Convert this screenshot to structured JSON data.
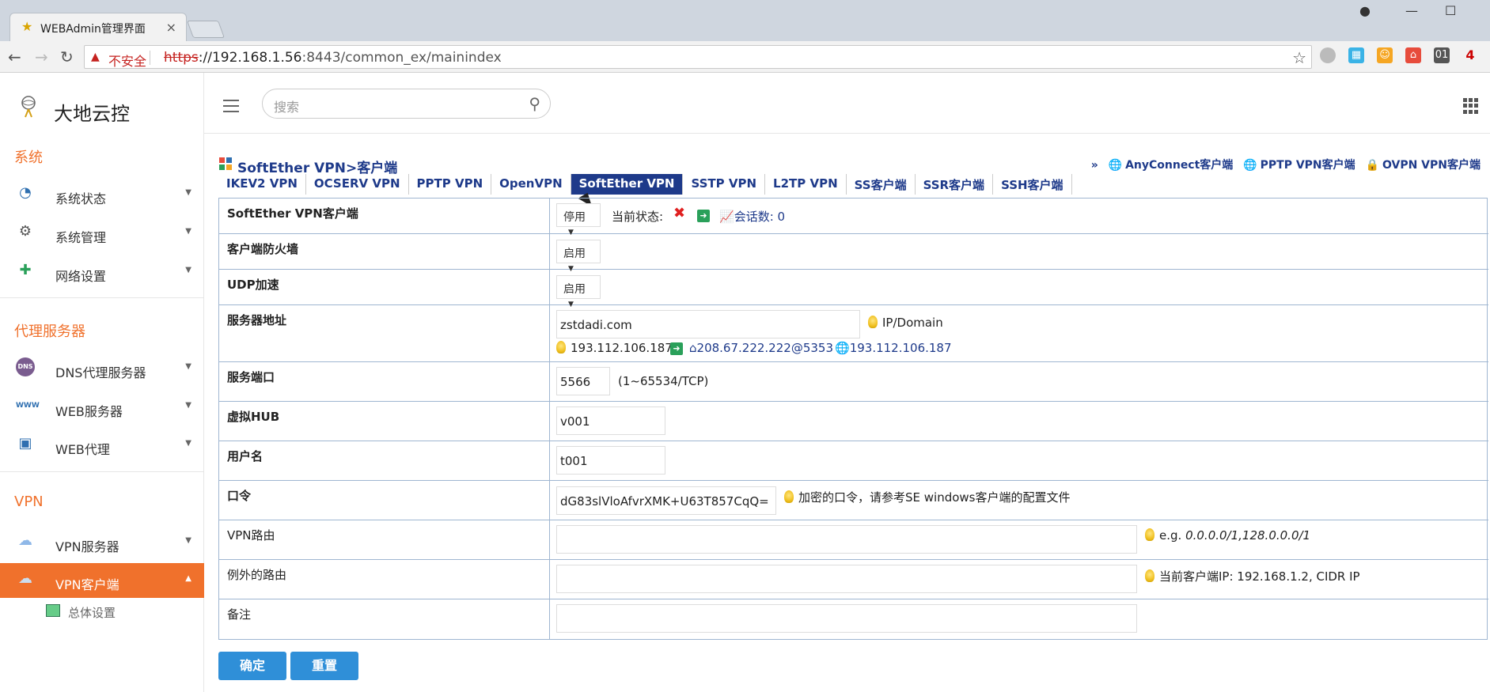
{
  "browser": {
    "tab_title": "WEBAdmin管理界面",
    "tab_close": "×",
    "insecure_label": "不安全",
    "url_proto": "https",
    "url_host": "://192.168.1.56",
    "url_rest": ":8443/common_ex/mainindex"
  },
  "app": {
    "logo_text": "大地云控",
    "search_placeholder": "搜索"
  },
  "sidebar": {
    "sections": [
      {
        "title": "系统",
        "items": [
          {
            "label": "系统状态",
            "icon": "gauge-icon"
          },
          {
            "label": "系统管理",
            "icon": "gears-icon"
          },
          {
            "label": "网络设置",
            "icon": "network-icon"
          }
        ]
      },
      {
        "title": "代理服务器",
        "items": [
          {
            "label": "DNS代理服务器",
            "icon": "dns-icon"
          },
          {
            "label": "WEB服务器",
            "icon": "www-icon"
          },
          {
            "label": "WEB代理",
            "icon": "monitor-icon"
          }
        ]
      },
      {
        "title": "VPN",
        "items": [
          {
            "label": "VPN服务器",
            "icon": "cloud-icon"
          },
          {
            "label": "VPN客户端",
            "icon": "cloud-icon"
          }
        ]
      }
    ],
    "sub_item": "总体设置"
  },
  "content": {
    "breadcrumb": "SoftEther VPN>客户端",
    "tabs": [
      "IKEV2 VPN",
      "OCSERV VPN",
      "PPTP VPN",
      "OpenVPN",
      "SoftEther VPN",
      "SSTP VPN",
      "L2TP VPN",
      "SS客户端",
      "SSR客户端",
      "SSH客户端"
    ],
    "active_tab": "SoftEther VPN",
    "right_links": {
      "prefix": "»",
      "anyconnect": "AnyConnect客户端",
      "pptp": "PPTP VPN客户端",
      "ovpn": "OVPN VPN客户端"
    },
    "form": {
      "client": {
        "label": "SoftEther VPN客户端",
        "select": "停用",
        "status_label": "当前状态:",
        "sessions": "会话数: 0"
      },
      "firewall": {
        "label": "客户端防火墙",
        "select": "启用"
      },
      "udp": {
        "label": "UDP加速",
        "select": "启用"
      },
      "server": {
        "label": "服务器地址",
        "value": "zstdadi.com",
        "hint": "IP/Domain",
        "resolved_ip": "193.112.106.187",
        "dns": "208.67.222.222@5353",
        "geo_ip": "193.112.106.187"
      },
      "port": {
        "label": "服务端口",
        "value": "5566",
        "hint": "(1~65534/TCP)"
      },
      "hub": {
        "label": "虚拟HUB",
        "value": "v001"
      },
      "user": {
        "label": "用户名",
        "value": "t001"
      },
      "password": {
        "label": "口令",
        "value": "dG83slVloAfvrXMK+U63T857CqQ=",
        "hint": "加密的口令，请参考SE windows客户端的配置文件"
      },
      "route": {
        "label": "VPN路由",
        "value": "",
        "hint_prefix": "e.g.",
        "hint_example": "0.0.0.0/1,128.0.0.0/1"
      },
      "except_route": {
        "label": "例外的路由",
        "value": "",
        "hint": "当前客户端IP: 192.168.1.2, CIDR IP"
      },
      "remark": {
        "label": "备注",
        "value": ""
      }
    },
    "buttons": {
      "ok": "确定",
      "reset": "重置"
    }
  },
  "colors": {
    "accent": "#f0712c",
    "link": "#1e3a8a",
    "button": "#2f8fd8"
  }
}
